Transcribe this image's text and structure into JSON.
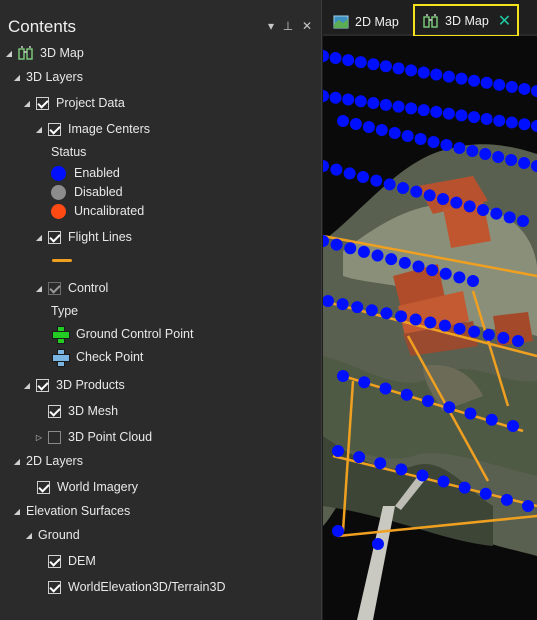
{
  "contents": {
    "title": "Contents",
    "controls": {
      "menu": "▾",
      "pin": "⊥",
      "close": "✕"
    },
    "tree": {
      "map_name": "3D Map",
      "layers_3d": "3D Layers",
      "project_data": "Project Data",
      "image_centers": "Image Centers",
      "status_heading": "Status",
      "status_items": [
        {
          "label": "Enabled",
          "color": "#0010ff"
        },
        {
          "label": "Disabled",
          "color": "#8c8c8c"
        },
        {
          "label": "Uncalibrated",
          "color": "#ff4a14"
        }
      ],
      "flight_lines": "Flight Lines",
      "flight_line_color": "#f0a020",
      "control": "Control",
      "type_heading": "Type",
      "control_types": [
        {
          "label": "Ground Control Point",
          "color": "#22cc22"
        },
        {
          "label": "Check Point",
          "color": "#7ab4e0"
        }
      ],
      "products_3d": "3D Products",
      "mesh_3d": "3D Mesh",
      "point_cloud_3d": "3D Point Cloud",
      "layers_2d": "2D Layers",
      "world_imagery": "World Imagery",
      "elevation_surfaces": "Elevation Surfaces",
      "ground": "Ground",
      "dem": "DEM",
      "world_elevation": "WorldElevation3D/Terrain3D"
    }
  },
  "tabs": {
    "tab_2d": "2D Map",
    "tab_3d": "3D Map",
    "close": "✕",
    "highlight_color": "#f5e21b"
  }
}
